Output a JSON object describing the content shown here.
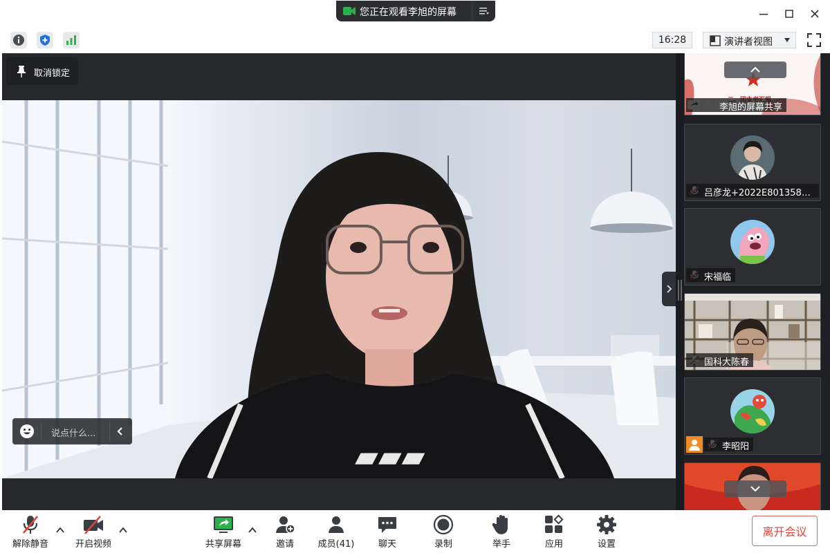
{
  "window": {
    "share_banner_text": "您正在观看李旭的屏幕"
  },
  "toolbar": {
    "clock": "16:28",
    "view_mode": "演讲者视图"
  },
  "stage": {
    "unlock_label": "取消锁定",
    "chat_placeholder": "说点什么..."
  },
  "participants": [
    {
      "name": "李旭的屏幕共享",
      "type": "screen-share",
      "mic": "on"
    },
    {
      "name": "吕彦龙+2022E80135860...",
      "type": "avatar",
      "mic": "muted"
    },
    {
      "name": "宋福临",
      "type": "avatar",
      "mic": "muted"
    },
    {
      "name": "国科大陈春",
      "type": "video",
      "mic": "muted"
    },
    {
      "name": "李昭阳",
      "type": "avatar",
      "mic": "muted"
    },
    {
      "name": "",
      "type": "video",
      "mic": "none"
    }
  ],
  "screen_share_slide_text": "二、团支书汇报",
  "bottom_bar": {
    "unmute": "解除静音",
    "start_video": "开启视频",
    "share_screen": "共享屏幕",
    "invite": "邀请",
    "members": "成员(41)",
    "chat": "聊天",
    "record": "录制",
    "raise_hand": "举手",
    "apps": "应用",
    "settings": "设置",
    "leave": "离开会议"
  },
  "colors": {
    "accent_green": "#2bb24c",
    "leave_red": "#e0443a",
    "stage_bg": "#26282b",
    "panel_bg": "#1e2023"
  }
}
